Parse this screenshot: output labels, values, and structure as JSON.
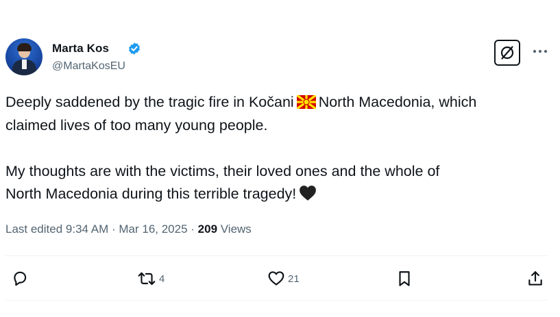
{
  "author": {
    "name": "Marta Kos",
    "handle": "@MartaKosEU"
  },
  "post": {
    "line1_a": "Deeply saddened by the tragic fire in Kočani",
    "line1_b": "North Macedonia, which",
    "line2": "claimed lives of too many young people.",
    "line3": "My thoughts are with the victims, their loved ones and the whole of",
    "line4": "North Macedonia during this terrible tragedy!"
  },
  "meta": {
    "edited_label": "Last edited 9:34 AM · Mar 16, 2025 · ",
    "views_count": "209",
    "views_label": " Views"
  },
  "actions": {
    "reposts": "4",
    "likes": "21"
  },
  "colors": {
    "verified_blue": "#1d9bf0",
    "secondary_text": "#536471",
    "primary_text": "#0f1419",
    "flag_red": "#d20000",
    "flag_yellow": "#ffe600"
  },
  "icons": {
    "verified": "verified-badge-icon",
    "grok": "grok-icon",
    "more": "more-icon",
    "flag": "north-macedonia-flag-icon",
    "heart": "black-heart-icon",
    "reply": "reply-icon",
    "repost": "repost-icon",
    "like": "like-icon",
    "bookmark": "bookmark-icon",
    "share": "share-icon"
  }
}
